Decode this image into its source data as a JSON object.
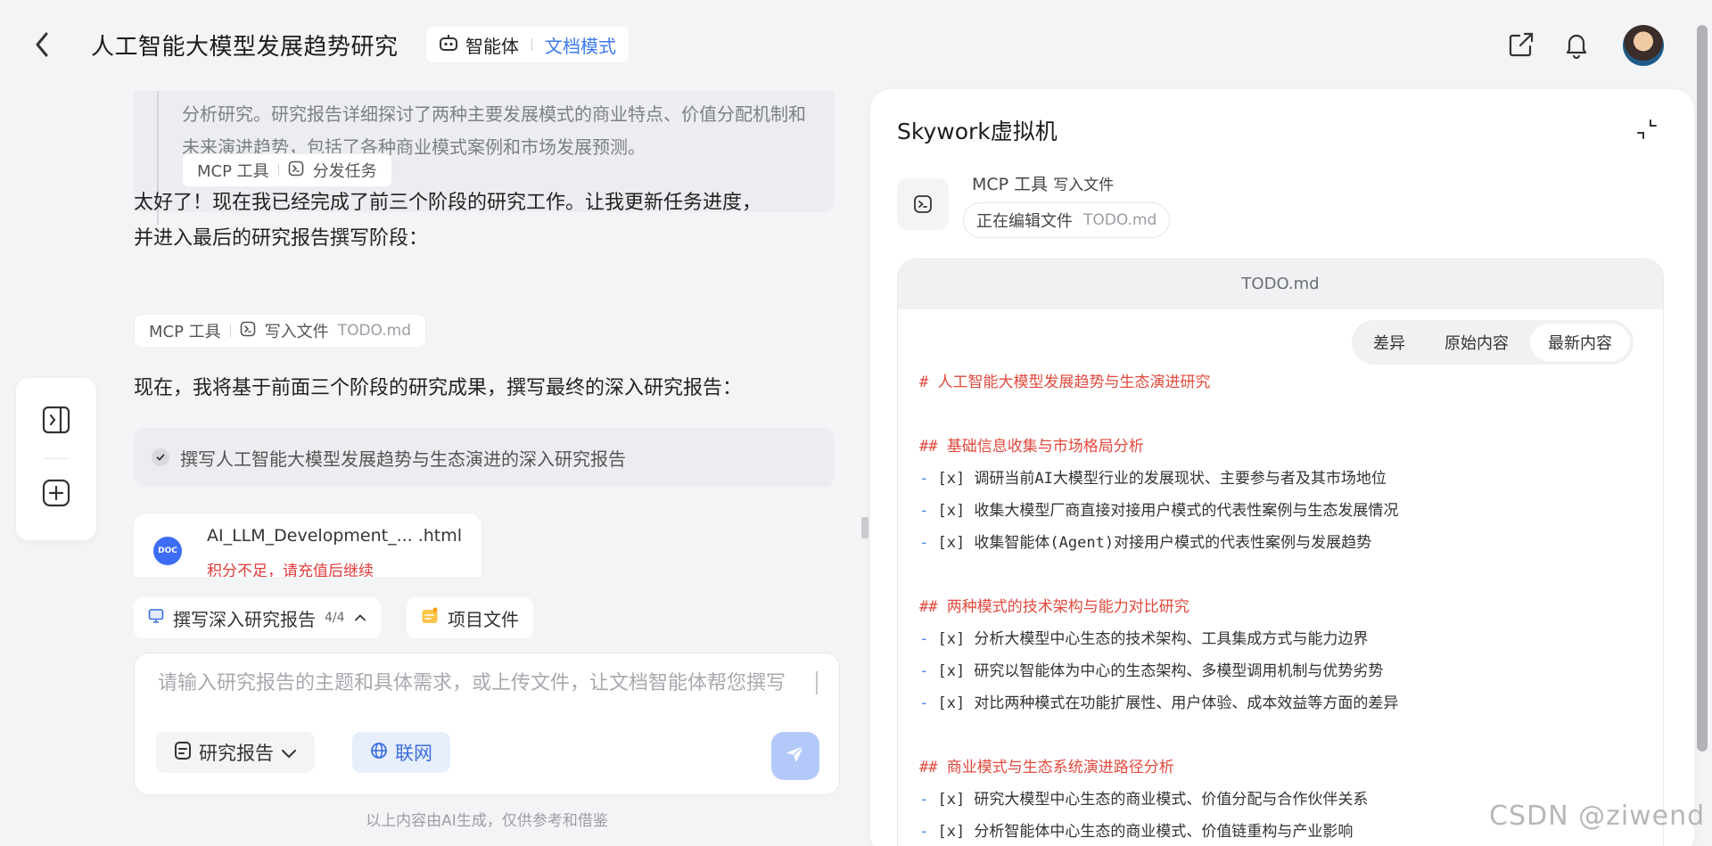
{
  "header": {
    "title": "人工智能大模型发展趋势研究",
    "agent_label": "智能体",
    "mode_label": "文档模式"
  },
  "chat": {
    "quote_text": "分析研究。研究报告详细探讨了两种主要发展模式的商业特点、价值分配机制和未来演进趋势，包括了各种商业模式案例和市场发展预测。",
    "chip1": {
      "mcp": "MCP 工具",
      "action": "分发任务"
    },
    "msg1_line1": "太好了！现在我已经完成了前三个阶段的研究工作。让我更新任务进度，",
    "msg1_line2": "并进入最后的研究报告撰写阶段：",
    "chip2": {
      "mcp": "MCP 工具",
      "action": "写入文件",
      "file": "TODO.md"
    },
    "msg2": "现在，我将基于前面三个阶段的研究成果，撰写最终的深入研究报告：",
    "task": "撰写人工智能大模型发展趋势与生态演进的深入研究报告",
    "file": {
      "badge": "DOC",
      "name": "AI_LLM_Development_... .html",
      "warning": "积分不足，请充值后继续"
    }
  },
  "bottom": {
    "progress_label": "撰写深入研究报告",
    "progress_count": "4/4",
    "project_files": "项目文件",
    "input_placeholder": "请输入研究报告的主题和具体需求，或上传文件，让文档智能体帮您撰写",
    "report_btn": "研究报告",
    "web_btn": "联网",
    "footer": "以上内容由AI生成，仅供参考和借鉴"
  },
  "vm": {
    "title": "Skywork虚拟机",
    "action_mcp": "MCP 工具",
    "action": "写入文件",
    "status": "正在编辑文件",
    "status_file": "TODO.md",
    "editor_title": "TODO.md",
    "tabs": [
      "差异",
      "原始内容",
      "最新内容"
    ],
    "active_tab": "最新内容",
    "lines": [
      {
        "kind": "h",
        "text": "# 人工智能大模型发展趋势与生态演进研究"
      },
      {
        "kind": "gap",
        "text": ""
      },
      {
        "kind": "h",
        "text": "## 基础信息收集与市场格局分析"
      },
      {
        "kind": "item",
        "text": "[x] 调研当前AI大模型行业的发展现状、主要参与者及其市场地位"
      },
      {
        "kind": "item",
        "text": "[x] 收集大模型厂商直接对接用户模式的代表性案例与生态发展情况"
      },
      {
        "kind": "item",
        "text": "[x] 收集智能体(Agent)对接用户模式的代表性案例与发展趋势"
      },
      {
        "kind": "gap",
        "text": ""
      },
      {
        "kind": "h",
        "text": "## 两种模式的技术架构与能力对比研究"
      },
      {
        "kind": "item",
        "text": "[x] 分析大模型中心生态的技术架构、工具集成方式与能力边界"
      },
      {
        "kind": "item",
        "text": "[x] 研究以智能体为中心的生态架构、多模型调用机制与优势劣势"
      },
      {
        "kind": "item",
        "text": "[x] 对比两种模式在功能扩展性、用户体验、成本效益等方面的差异"
      },
      {
        "kind": "gap",
        "text": ""
      },
      {
        "kind": "h",
        "text": "## 商业模式与生态系统演进路径分析"
      },
      {
        "kind": "item",
        "text": "[x] 研究大模型中心生态的商业模式、价值分配与合作伙伴关系"
      },
      {
        "kind": "item",
        "text": "[x] 分析智能体中心生态的商业模式、价值链重构与产业影响"
      }
    ]
  },
  "watermark": "CSDN @ziwend",
  "colors": {
    "accent": "#3c7af0",
    "heading": "#e2493e",
    "warning": "#e03b3b"
  }
}
